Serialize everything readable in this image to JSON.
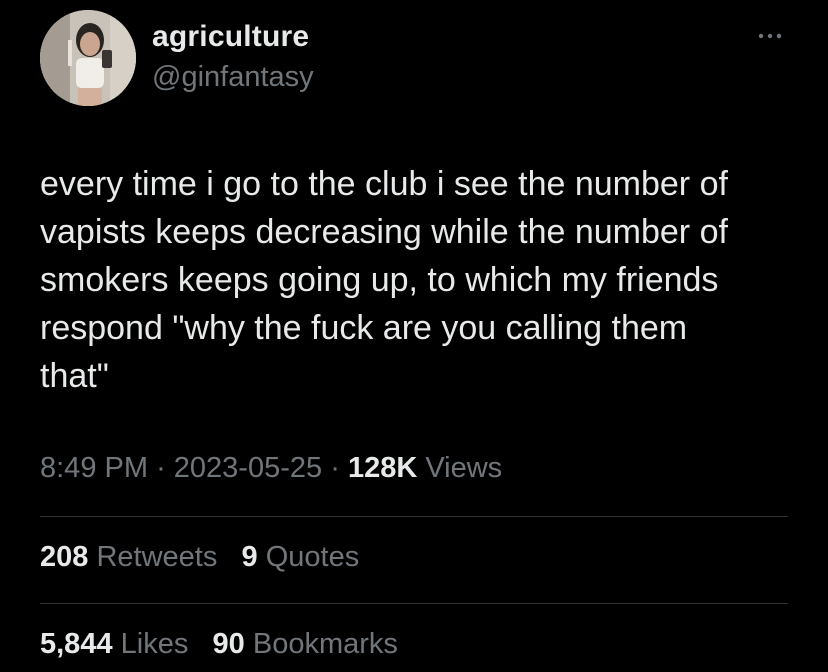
{
  "author": {
    "display_name": "agriculture",
    "handle": "@ginfantasy"
  },
  "tweet": {
    "lines": [
      "every time i go to the club i see the number of",
      "vapists keeps decreasing while the number of",
      "smokers keeps going up, to which my friends",
      "respond \"why the fuck are you calling them",
      "that\""
    ]
  },
  "meta": {
    "time": "8:49 PM",
    "separator": "·",
    "date": "2023-05-25",
    "views_count": "128K",
    "views_label": "Views"
  },
  "engagement": {
    "retweets_count": "208",
    "retweets_label": "Retweets",
    "quotes_count": "9",
    "quotes_label": "Quotes",
    "likes_count": "5,844",
    "likes_label": "Likes",
    "bookmarks_count": "90",
    "bookmarks_label": "Bookmarks"
  },
  "icons": {
    "more": "more-horizontal-icon"
  },
  "colors": {
    "background": "#000000",
    "primary_text": "#e7e9ea",
    "secondary_text": "#71767b",
    "divider": "#2f3336"
  }
}
